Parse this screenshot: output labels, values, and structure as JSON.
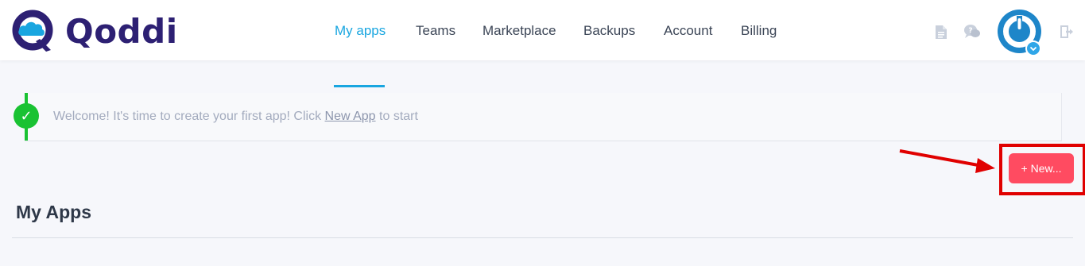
{
  "brand": {
    "name": "Qoddi",
    "primary_color": "#2d2073",
    "accent_color": "#19a6e0"
  },
  "nav": {
    "items": [
      {
        "label": "My apps",
        "active": true
      },
      {
        "label": "Teams",
        "active": false
      },
      {
        "label": "Marketplace",
        "active": false
      },
      {
        "label": "Backups",
        "active": false
      },
      {
        "label": "Account",
        "active": false
      },
      {
        "label": "Billing",
        "active": false
      }
    ]
  },
  "header_icons": [
    "document-icon",
    "help-chat-icon",
    "avatar",
    "logout-icon"
  ],
  "alert": {
    "icon": "check-icon",
    "text_before": "Welcome! It's time to create your first app! Click ",
    "link_text": "New App",
    "text_after": " to start",
    "status_color": "#19c232"
  },
  "new_button": {
    "label": "+ New...",
    "color": "#ff4b61"
  },
  "section": {
    "title": "My Apps"
  }
}
